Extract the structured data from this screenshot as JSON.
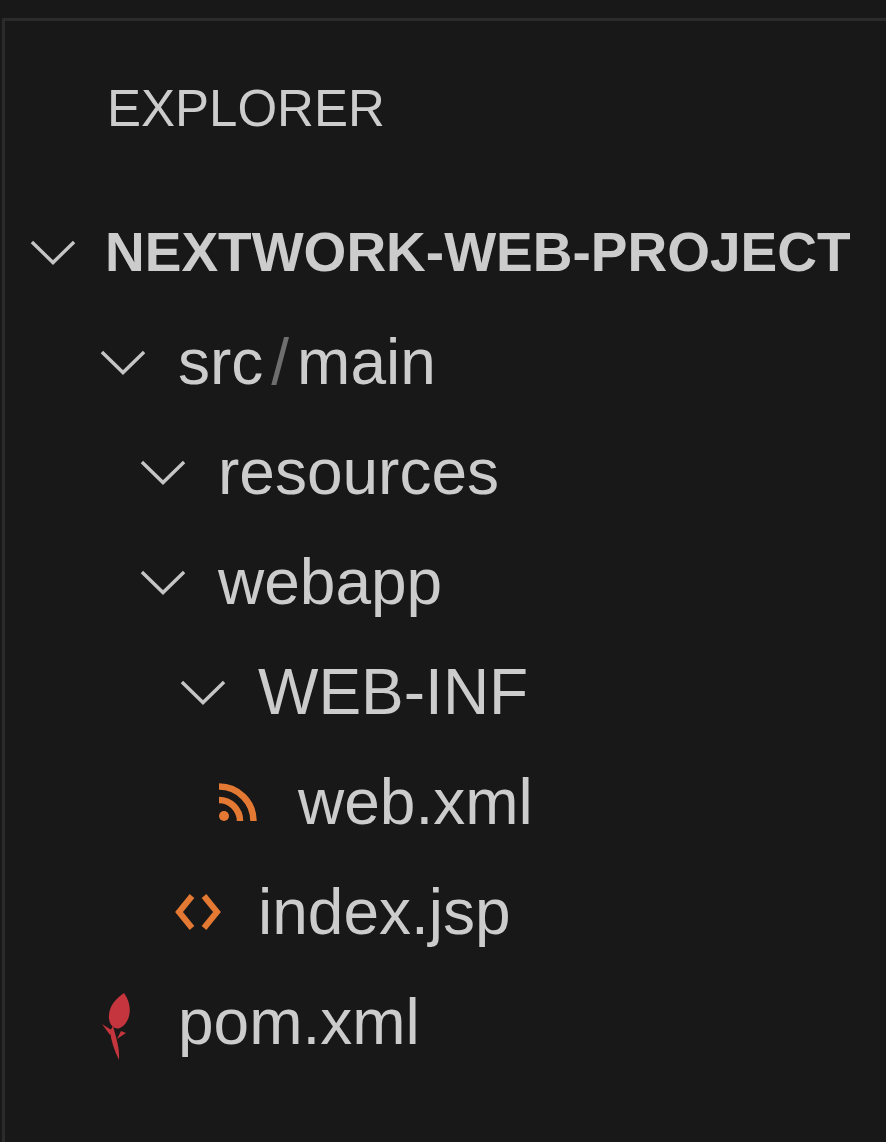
{
  "sidebar": {
    "title": "EXPLORER",
    "project": {
      "label": "NEXTWORK-WEB-PROJECT",
      "expanded": true,
      "children": [
        {
          "kind": "compact_folder",
          "segments": [
            "src",
            "main"
          ],
          "separator": "/",
          "expanded": true,
          "children": [
            {
              "kind": "folder",
              "label": "resources",
              "expanded": true
            },
            {
              "kind": "folder",
              "label": "webapp",
              "expanded": true,
              "children": [
                {
                  "kind": "folder",
                  "label": "WEB-INF",
                  "expanded": true,
                  "children": [
                    {
                      "kind": "xml",
                      "label": "web.xml"
                    }
                  ]
                },
                {
                  "kind": "jsp",
                  "label": "index.jsp"
                }
              ]
            }
          ]
        },
        {
          "kind": "pom",
          "label": "pom.xml"
        }
      ]
    }
  }
}
